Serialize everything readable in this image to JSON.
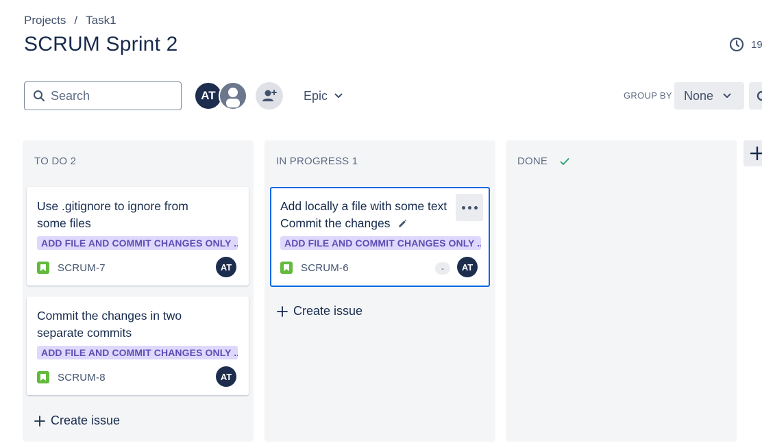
{
  "breadcrumb": {
    "projects": "Projects",
    "separator": "/",
    "current": "Task1"
  },
  "page_title": "SCRUM Sprint 2",
  "timer": {
    "icon": "clock-icon",
    "text": "19"
  },
  "search": {
    "placeholder": "Search"
  },
  "avatars": [
    {
      "initials": "AT"
    },
    {
      "icon": "user-icon"
    }
  ],
  "toolbar": {
    "epic_label": "Epic",
    "group_by_label": "GROUP BY",
    "group_by_value": "None"
  },
  "columns": [
    {
      "header": "TO DO 2",
      "cards": [
        {
          "title_line1": "Use .gitignore to ignore from",
          "title_line2": "some files",
          "epic": "ADD FILE AND COMMIT CHANGES ONLY ...",
          "key": "SCRUM-7",
          "assignee": "AT"
        },
        {
          "title_line1": "Commit the changes in two",
          "title_line2": "separate commits",
          "epic": "ADD FILE AND COMMIT CHANGES ONLY ...",
          "key": "SCRUM-8",
          "assignee": "AT"
        }
      ],
      "create_label": "Create issue"
    },
    {
      "header": "IN PROGRESS 1",
      "cards": [
        {
          "title_line1": "Add locally a file with some text",
          "title_line2": "Commit the changes",
          "epic": "ADD FILE AND COMMIT CHANGES ONLY ...",
          "key": "SCRUM-6",
          "estimate": "-",
          "assignee": "AT"
        }
      ],
      "create_label": "Create issue"
    },
    {
      "header": "DONE",
      "cards": []
    }
  ],
  "colors": {
    "brand_dark": "#1d2d4d",
    "epic_bg": "#dfd8fd",
    "epic_text": "#5e4db2",
    "story_green": "#63ba3c",
    "selection_blue": "#0c66e4",
    "done_check": "#22a06b"
  }
}
